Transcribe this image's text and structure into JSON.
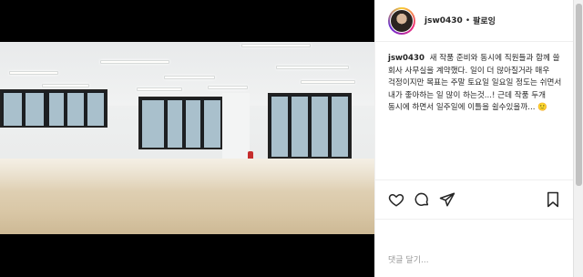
{
  "post": {
    "username": "jsw0430",
    "separator": "•",
    "follow_label": "팔로잉",
    "caption_user": "jsw0430",
    "caption_text": "새 작품 준비와 동시에 직원들과 함께 쓸 회사 사무실을 계약했다. 일이 더 많아질거라 매우 걱정이지만 목표는 주말 토요일 일요일 정도는 쉬면서 내가 좋아하는 일 많이 하는것...! 근데 작품 두개 동시에 하면서 일주일에 이틀을 쉴수있을까...",
    "caption_emoji": "🙂",
    "comment_placeholder": "댓글 달기...",
    "icons": [
      "heart-icon",
      "comment-icon",
      "share-icon",
      "bookmark-icon"
    ]
  },
  "colors": {
    "text": "#262626",
    "border": "#efefef",
    "placeholder": "#999999"
  }
}
